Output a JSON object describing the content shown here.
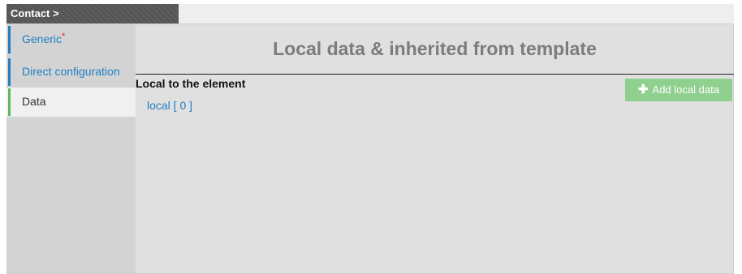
{
  "breadcrumb": {
    "label": "Contact >"
  },
  "tabs": [
    {
      "label": "Generic",
      "required_marker": "*"
    },
    {
      "label": "Direct configuration"
    },
    {
      "label": "Data"
    }
  ],
  "main": {
    "title": "Local data & inherited from template",
    "section_title": "Local to the element",
    "add_button": {
      "icon": "plus-icon",
      "label": "Add local data"
    },
    "local_link": "local [ 0 ]"
  },
  "colors": {
    "link": "#1f7fc4",
    "active_tab_bar": "#5cb85c",
    "add_button": "#8fd08f",
    "required": "#e3242b",
    "breadcrumb_bg": "#555555"
  }
}
